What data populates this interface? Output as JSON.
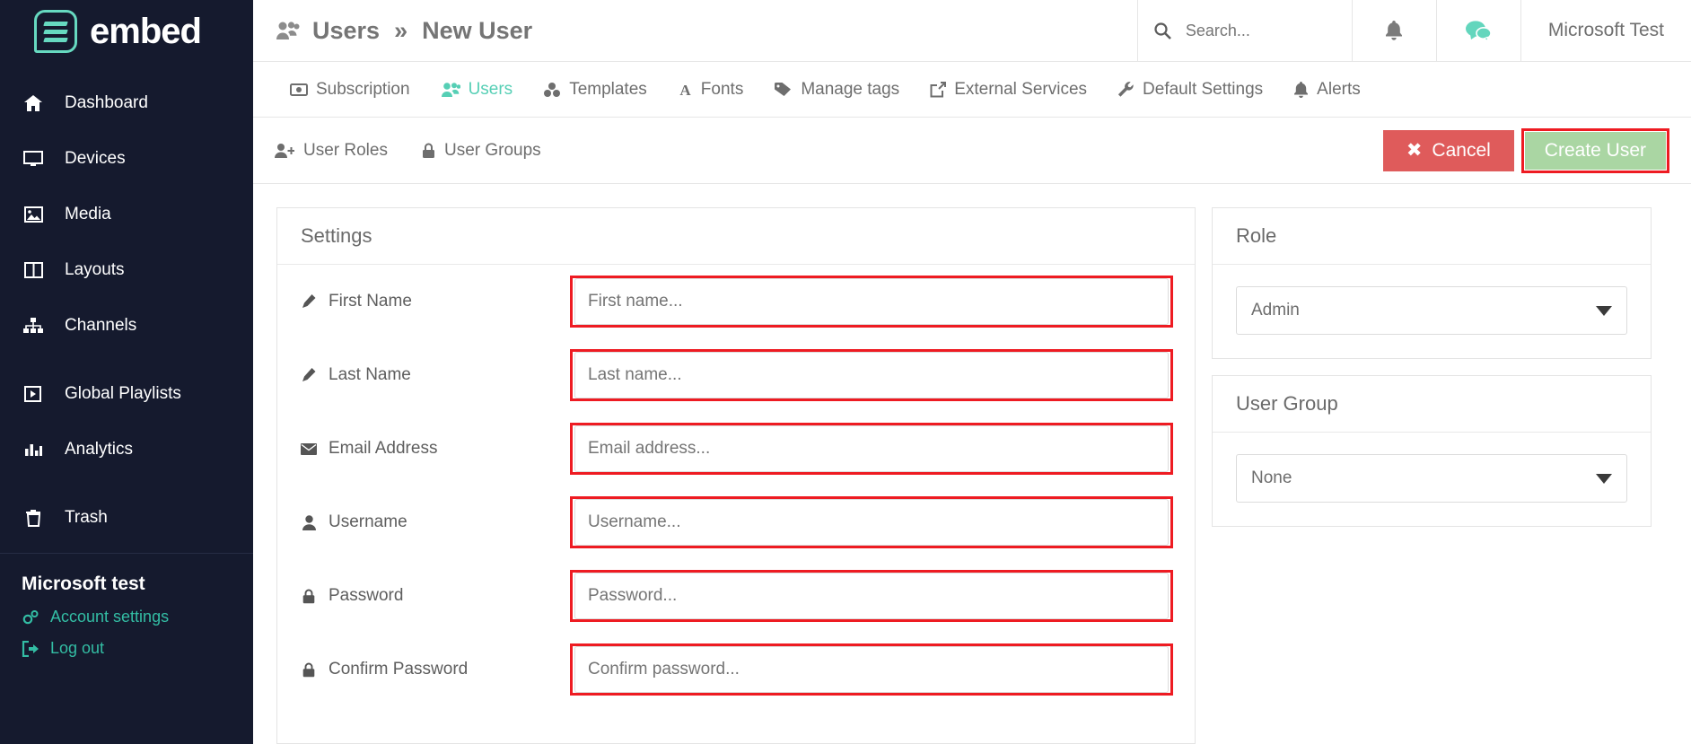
{
  "brand": {
    "name": "embed",
    "accent": "#66d9c0"
  },
  "sidebar": {
    "items": [
      {
        "label": "Dashboard",
        "icon": "home-icon"
      },
      {
        "label": "Devices",
        "icon": "desktop-icon"
      },
      {
        "label": "Media",
        "icon": "image-icon"
      },
      {
        "label": "Layouts",
        "icon": "columns-icon"
      },
      {
        "label": "Channels",
        "icon": "sitemap-icon"
      },
      {
        "label": "Global Playlists",
        "icon": "play-box-icon"
      },
      {
        "label": "Analytics",
        "icon": "bar-chart-icon"
      },
      {
        "label": "Trash",
        "icon": "trash-icon"
      }
    ],
    "account": {
      "name": "Microsoft test",
      "settings_label": "Account settings",
      "logout_label": "Log out"
    }
  },
  "header": {
    "breadcrumb_parent": "Users",
    "breadcrumb_separator": "»",
    "breadcrumb_current": "New User",
    "search_placeholder": "Search...",
    "search_value": "",
    "user_name": "Microsoft Test"
  },
  "tabs": [
    {
      "label": "Subscription",
      "icon": "money-icon",
      "active": false
    },
    {
      "label": "Users",
      "icon": "users-icon",
      "active": true
    },
    {
      "label": "Templates",
      "icon": "cubes-icon",
      "active": false
    },
    {
      "label": "Fonts",
      "icon": "font-icon",
      "active": false
    },
    {
      "label": "Manage tags",
      "icon": "tag-icon",
      "active": false
    },
    {
      "label": "External Services",
      "icon": "external-link-icon",
      "active": false
    },
    {
      "label": "Default Settings",
      "icon": "wrench-icon",
      "active": false
    },
    {
      "label": "Alerts",
      "icon": "bell-icon",
      "active": false
    }
  ],
  "subnav": [
    {
      "label": "User Roles",
      "icon": "user-plus-icon"
    },
    {
      "label": "User Groups",
      "icon": "lock-icon"
    }
  ],
  "actions": {
    "cancel_label": "Cancel",
    "create_label": "Create User",
    "cancel_color": "#df5b5b",
    "create_color": "#aad6a3",
    "highlight_color": "#ee1b22"
  },
  "settings_panel": {
    "title": "Settings",
    "fields": [
      {
        "label": "First Name",
        "icon": "pencil-icon",
        "placeholder": "First name...",
        "value": ""
      },
      {
        "label": "Last Name",
        "icon": "pencil-icon",
        "placeholder": "Last name...",
        "value": ""
      },
      {
        "label": "Email Address",
        "icon": "envelope-icon",
        "placeholder": "Email address...",
        "value": ""
      },
      {
        "label": "Username",
        "icon": "user-icon",
        "placeholder": "Username...",
        "value": ""
      },
      {
        "label": "Password",
        "icon": "lock-icon",
        "placeholder": "Password...",
        "value": ""
      },
      {
        "label": "Confirm Password",
        "icon": "lock-icon",
        "placeholder": "Confirm password...",
        "value": ""
      }
    ]
  },
  "role_panel": {
    "title": "Role",
    "selected": "Admin"
  },
  "group_panel": {
    "title": "User Group",
    "selected": "None"
  }
}
